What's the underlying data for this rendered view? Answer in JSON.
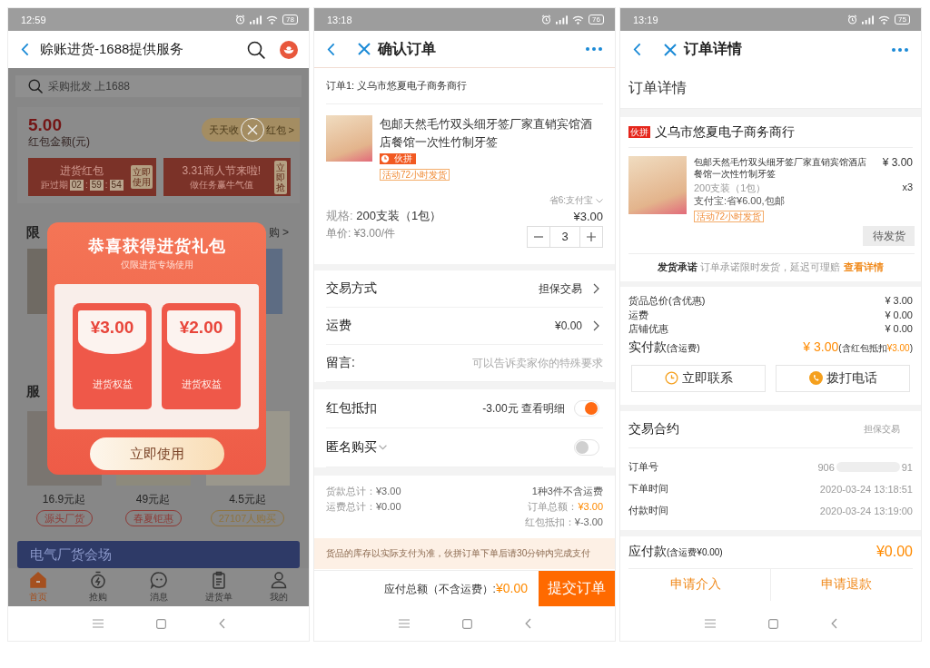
{
  "home_screen": {
    "status_bar": {
      "time": "12:59",
      "battery": "78"
    },
    "header": {
      "title": "赊账进货-1688提供服务"
    },
    "search": {
      "placeholder": "采购批发 上1688"
    },
    "balance": {
      "amount": "5.00",
      "label": "红包金额(元)",
      "pill_start": "天天收",
      "pill_end": "红包 >"
    },
    "coupons": [
      {
        "kind": "countdown",
        "title": "进货红包",
        "expiry_label": "距过期",
        "countdown": [
          "02",
          "59",
          "54"
        ],
        "separator": ":",
        "action": "立即使用"
      },
      {
        "kind": "task",
        "title": "3.31商人节来啦!",
        "subtitle": "做任务赢牛气值",
        "action": "立即抢"
      }
    ],
    "sections": [
      {
        "title": "限",
        "more": "购 >"
      },
      {
        "title": "服"
      }
    ],
    "products": [
      {
        "price": "16.9元起",
        "tag": "源头厂货",
        "color": "#8e3a36"
      },
      {
        "price": "49元起",
        "tag": "春夏钜惠",
        "color": "#8e3a36"
      },
      {
        "price": "4.5元起",
        "tag": "27107人购买",
        "color": "#8f7440"
      }
    ],
    "banner": {
      "title": "电气厂货会场"
    },
    "tabs": [
      {
        "label": "首页",
        "selected": true
      },
      {
        "label": "抢购",
        "selected": false
      },
      {
        "label": "消息",
        "selected": false
      },
      {
        "label": "进货单",
        "selected": false
      },
      {
        "label": "我的",
        "selected": false
      }
    ],
    "popup": {
      "title": "恭喜获得进货礼包",
      "subtitle": "仅限进货专场使用",
      "envelopes": [
        {
          "amount": "¥3.00",
          "label": "进货权益"
        },
        {
          "amount": "¥2.00",
          "label": "进货权益"
        }
      ],
      "button": "立即使用"
    }
  },
  "confirm_order_screen": {
    "status_bar": {
      "time": "13:18",
      "battery": "76"
    },
    "header": {
      "title": "确认订单"
    },
    "order_label": "订单1: 义乌市悠夏电子商务商行",
    "product": {
      "title": "包邮天然毛竹双头细牙签厂家直销宾馆酒店餐馆一次性竹制牙签",
      "group_tag": "伙拼",
      "shipping_tag": "活动72小时发货",
      "discount": "省6:支付宝",
      "spec_label": "规格: ",
      "spec": "200支装（1包）",
      "price": "¥3.00",
      "unit_price": "单价: ¥3.00/件",
      "quantity": "3"
    },
    "options": [
      {
        "kind": "link",
        "label": "交易方式",
        "value": "担保交易"
      },
      {
        "kind": "link",
        "label": "运费",
        "value": "¥0.00"
      },
      {
        "kind": "input",
        "label": "留言:",
        "placeholder": "可以告诉卖家你的特殊要求"
      }
    ],
    "switches": [
      {
        "kind": "detail",
        "label": "红包抵扣",
        "detail": "-3.00元 查看明细",
        "on": true
      },
      {
        "kind": "dropdown",
        "label": "匿名购买",
        "on": false
      }
    ],
    "summary": {
      "left_lines": [
        {
          "label": "货款总计：",
          "value": "¥3.00"
        },
        {
          "label": "运费总计：",
          "value": "¥0.00"
        }
      ],
      "count_note": "1种3件不含运费",
      "right_lines": [
        {
          "label": "订单总额：",
          "value": "¥3.00",
          "highlight": true
        },
        {
          "label": "红包抵扣：",
          "value": "¥-3.00",
          "highlight": false
        }
      ]
    },
    "notice": "货品的库存以实际支付为准，伙拼订单下单后请30分钟内完成支付",
    "footer": {
      "total_label": "应付总额（不含运费）:",
      "total": "¥0.00",
      "submit": "提交订单"
    }
  },
  "order_detail_screen": {
    "status_bar": {
      "time": "13:19",
      "battery": "75"
    },
    "header": {
      "title": "订单详情"
    },
    "section_title": "订单详情",
    "shop": {
      "badge": "伙拼",
      "name": "义乌市悠夏电子商务商行"
    },
    "product": {
      "title": "包邮天然毛竹双头细牙签厂家直销宾馆酒店餐馆一次性竹制牙签",
      "price": "¥ 3.00",
      "spec": "200支装（1包）",
      "quantity": "x3",
      "promo": "支付宝:省¥6.00,包邮",
      "shipping_tag": "活动72小时发货",
      "status": "待发货"
    },
    "promise": {
      "text": "**发货承诺** 订单承诺限时发货，延迟可理赔",
      "link": "查看详情"
    },
    "costs": [
      {
        "label": "货品总价(含优惠)",
        "value": "¥ 3.00"
      },
      {
        "label": "运费",
        "value": "¥ 0.00"
      },
      {
        "label": "店铺优惠",
        "value": "¥ 0.00"
      }
    ],
    "paid": {
      "label": "实付款",
      "note": "(含运费)",
      "amount": "¥ 3.00",
      "detail_start": "(含红包抵扣",
      "detail_amount": "¥3.00",
      "detail_end": ")"
    },
    "actions": [
      {
        "kind": "contact",
        "label": "立即联系"
      },
      {
        "kind": "call",
        "label": "拨打电话"
      }
    ],
    "contract": {
      "title": "交易合约",
      "value": "担保交易"
    },
    "order_number": {
      "label": "订单号",
      "start": "906",
      "end": "91"
    },
    "times": [
      {
        "label": "下单时间",
        "value": "2020-03-24 13:18:51"
      },
      {
        "label": "付款时间",
        "value": "2020-03-24 13:19:00"
      }
    ],
    "due": {
      "label": "应付款",
      "note": "(含运费¥0.00)",
      "amount": "¥0.00"
    },
    "buttons": [
      {
        "label": "申请介入"
      },
      {
        "label": "申请退款"
      }
    ]
  }
}
